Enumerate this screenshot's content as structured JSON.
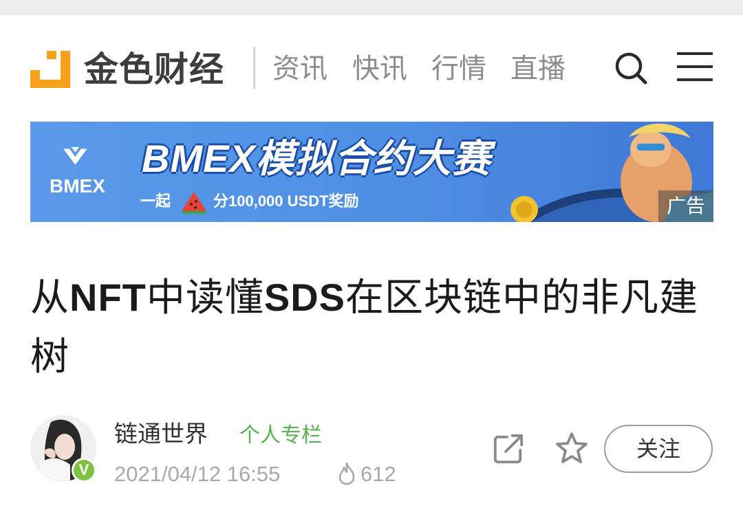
{
  "header": {
    "brand": "金色财经",
    "nav": [
      "资讯",
      "快讯",
      "行情",
      "直播"
    ],
    "icons": {
      "search": "search-icon",
      "menu": "menu-icon"
    },
    "brand_color": "#f5a11c"
  },
  "banner": {
    "logo_text": "BMEX",
    "headline": "BMEX模拟合约大赛",
    "sub_a": "一起",
    "sub_b": "分100,000 USDT奖励",
    "ad_badge": "广告"
  },
  "article": {
    "title_parts": [
      "从",
      "NFT",
      "中读懂",
      "SDS",
      "在区块链中的非凡建树"
    ]
  },
  "author": {
    "name": "链通世界",
    "column_tag": "个人专栏",
    "verified_badge": "V",
    "datetime": "2021/04/12 16:55",
    "views": "612",
    "follow_label": "关注",
    "icons": {
      "share": "share-icon",
      "favorite": "star-icon",
      "heat": "flame-icon"
    }
  },
  "colors": {
    "accent_green": "#56b24e",
    "verified_green": "#7ec242",
    "banner_blue": "#4f8fe4"
  }
}
